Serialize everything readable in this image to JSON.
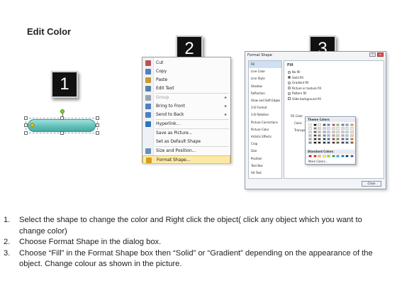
{
  "title": "Edit Color",
  "step_numbers": [
    "1",
    "2",
    "3"
  ],
  "context_menu": {
    "items": [
      {
        "label": "Cut",
        "icon": "scissors-icon",
        "icon_color": "#c0504d",
        "disabled": false,
        "submenu": false
      },
      {
        "label": "Copy",
        "icon": "copy-icon",
        "icon_color": "#4f81bd",
        "disabled": false,
        "submenu": false
      },
      {
        "label": "Paste",
        "icon": "paste-icon",
        "icon_color": "#c99a2e",
        "disabled": false,
        "submenu": false
      },
      {
        "label": "Edit Text",
        "icon": "edit-text-icon",
        "icon_color": "#5b7fa8",
        "disabled": false,
        "submenu": false
      },
      {
        "label": "Group",
        "icon": "group-icon",
        "icon_color": "#9aa4b0",
        "disabled": true,
        "submenu": true
      },
      {
        "label": "Bring to Front",
        "icon": "bring-front-icon",
        "icon_color": "#4f81bd",
        "disabled": false,
        "submenu": true
      },
      {
        "label": "Send to Back",
        "icon": "send-back-icon",
        "icon_color": "#4f81bd",
        "disabled": false,
        "submenu": true
      },
      {
        "label": "Hyperlink...",
        "icon": "hyperlink-icon",
        "icon_color": "#2e75b6",
        "disabled": false,
        "submenu": false
      },
      {
        "label": "Save as Picture...",
        "icon": "",
        "icon_color": "",
        "disabled": false,
        "submenu": false
      },
      {
        "label": "Set as Default Shape",
        "icon": "",
        "icon_color": "",
        "disabled": false,
        "submenu": false
      },
      {
        "label": "Size and Position...",
        "icon": "size-position-icon",
        "icon_color": "#6a8fb5",
        "disabled": false,
        "submenu": false
      },
      {
        "label": "Format Shape...",
        "icon": "format-shape-icon",
        "icon_color": "#d4a017",
        "disabled": false,
        "submenu": false,
        "highlighted": true
      }
    ]
  },
  "format_dialog": {
    "title": "Format Shape",
    "window_buttons": [
      "?",
      "x"
    ],
    "categories": [
      "Fill",
      "Line Color",
      "Line Style",
      "Shadow",
      "Reflection",
      "Glow and Soft Edges",
      "3-D Format",
      "3-D Rotation",
      "Picture Corrections",
      "Picture Color",
      "Artistic Effects",
      "Crop",
      "Size",
      "Position",
      "Text Box",
      "Alt Text"
    ],
    "selected_category": "Fill",
    "fill_heading": "Fill",
    "options": [
      {
        "label": "No fill",
        "type": "radio",
        "checked": false
      },
      {
        "label": "Solid fill",
        "type": "radio",
        "checked": true
      },
      {
        "label": "Gradient fill",
        "type": "radio",
        "checked": false
      },
      {
        "label": "Picture or texture fill",
        "type": "radio",
        "checked": false
      },
      {
        "label": "Pattern fill",
        "type": "radio",
        "checked": false
      },
      {
        "label": "Slide background fill",
        "type": "checkbox",
        "checked": false
      }
    ],
    "fill_color_label": "Fill Color",
    "color_label": "Color:",
    "transparency_label": "Transpa",
    "close_label": "Close"
  },
  "color_picker": {
    "theme_heading": "Theme Colors",
    "theme_colors": [
      "#ffffff",
      "#000000",
      "#eeece1",
      "#1f497d",
      "#4f81bd",
      "#c0504d",
      "#9bbb59",
      "#8064a2",
      "#4bacc6",
      "#f79646",
      "#f2f2f2",
      "#7f7f7f",
      "#ddd9c3",
      "#c6d9f0",
      "#dbe5f1",
      "#f2dcdb",
      "#ebf1dd",
      "#e5e0ec",
      "#dbeef3",
      "#fdeada",
      "#d8d8d8",
      "#595959",
      "#c4bd97",
      "#8db3e2",
      "#b8cce4",
      "#e5b9b7",
      "#d7e3bc",
      "#ccc1d9",
      "#b7dde8",
      "#fbd5b5",
      "#bfbfbf",
      "#3f3f3f",
      "#938953",
      "#548dd4",
      "#95b3d7",
      "#d99694",
      "#c3d69b",
      "#b2a2c7",
      "#92cddc",
      "#fac08f",
      "#a5a5a5",
      "#262626",
      "#494429",
      "#17365d",
      "#366092",
      "#953734",
      "#76923c",
      "#5f497a",
      "#31859b",
      "#e36c09",
      "#7f7f7f",
      "#0c0c0c",
      "#1d1b10",
      "#0f243e",
      "#244061",
      "#632423",
      "#4f6128",
      "#3f3151",
      "#205867",
      "#974806"
    ],
    "standard_heading": "Standard Colors",
    "standard_colors": [
      "#c00000",
      "#ff0000",
      "#ffc000",
      "#ffff00",
      "#92d050",
      "#00b050",
      "#00b0f0",
      "#0070c0",
      "#002060",
      "#7030a0"
    ],
    "more_label": "More Colors..."
  },
  "steps": [
    {
      "num": "1.",
      "text": "Select the shape to change the color and Right click the object( click any object which you want to change color)"
    },
    {
      "num": "2.",
      "text": "Choose Format Shape in the dialog box."
    },
    {
      "num": "3.",
      "text": "Choose “Fill” in the Format Shape box then “Solid” or “Gradient” depending on the appearance of the object. Change colour as shown in the picture."
    }
  ]
}
